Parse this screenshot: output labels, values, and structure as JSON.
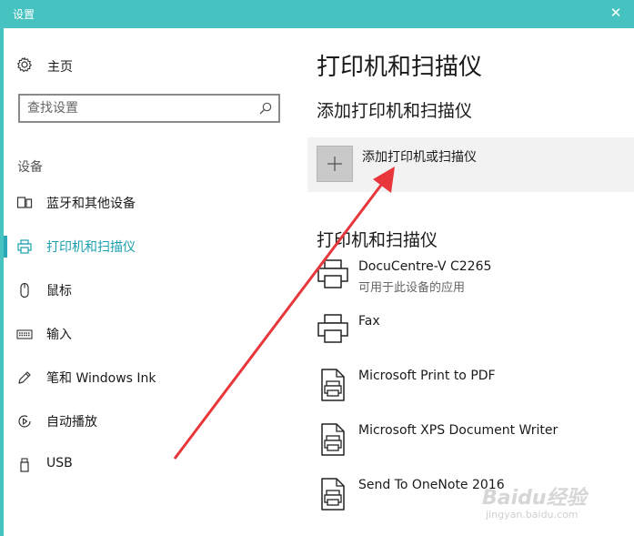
{
  "window": {
    "title": "设置",
    "close_glyph": "✕"
  },
  "sidebar": {
    "home_label": "主页",
    "search_placeholder": "查找设置",
    "section_title": "设备",
    "items": [
      {
        "label": "蓝牙和其他设备",
        "icon": "bluetooth-devices-icon"
      },
      {
        "label": "打印机和扫描仪",
        "icon": "printer-icon",
        "active": true
      },
      {
        "label": "鼠标",
        "icon": "mouse-icon"
      },
      {
        "label": "输入",
        "icon": "keyboard-icon"
      },
      {
        "label": "笔和 Windows Ink",
        "icon": "pen-icon"
      },
      {
        "label": "自动播放",
        "icon": "autoplay-icon"
      },
      {
        "label": "USB",
        "icon": "usb-icon"
      }
    ]
  },
  "main": {
    "page_title": "打印机和扫描仪",
    "add_section_title": "添加打印机和扫描仪",
    "add_button_label": "添加打印机或扫描仪",
    "list_section_title": "打印机和扫描仪",
    "devices": [
      {
        "name": "DocuCentre-V C2265",
        "status": "可用于此设备的应用",
        "icon": "printer-icon"
      },
      {
        "name": "Fax",
        "status": "",
        "icon": "printer-icon"
      },
      {
        "name": "Microsoft Print to PDF",
        "status": "",
        "icon": "document-printer-icon"
      },
      {
        "name": "Microsoft XPS Document Writer",
        "status": "",
        "icon": "document-printer-icon"
      },
      {
        "name": "Send To OneNote 2016",
        "status": "",
        "icon": "document-printer-icon"
      }
    ]
  },
  "watermark": {
    "text": "Baidu经验",
    "sub": "jingyan.baidu.com"
  },
  "colors": {
    "titlebar": "#46c2c0",
    "accent": "#1a9fb0",
    "arrow": "#e8363a"
  }
}
